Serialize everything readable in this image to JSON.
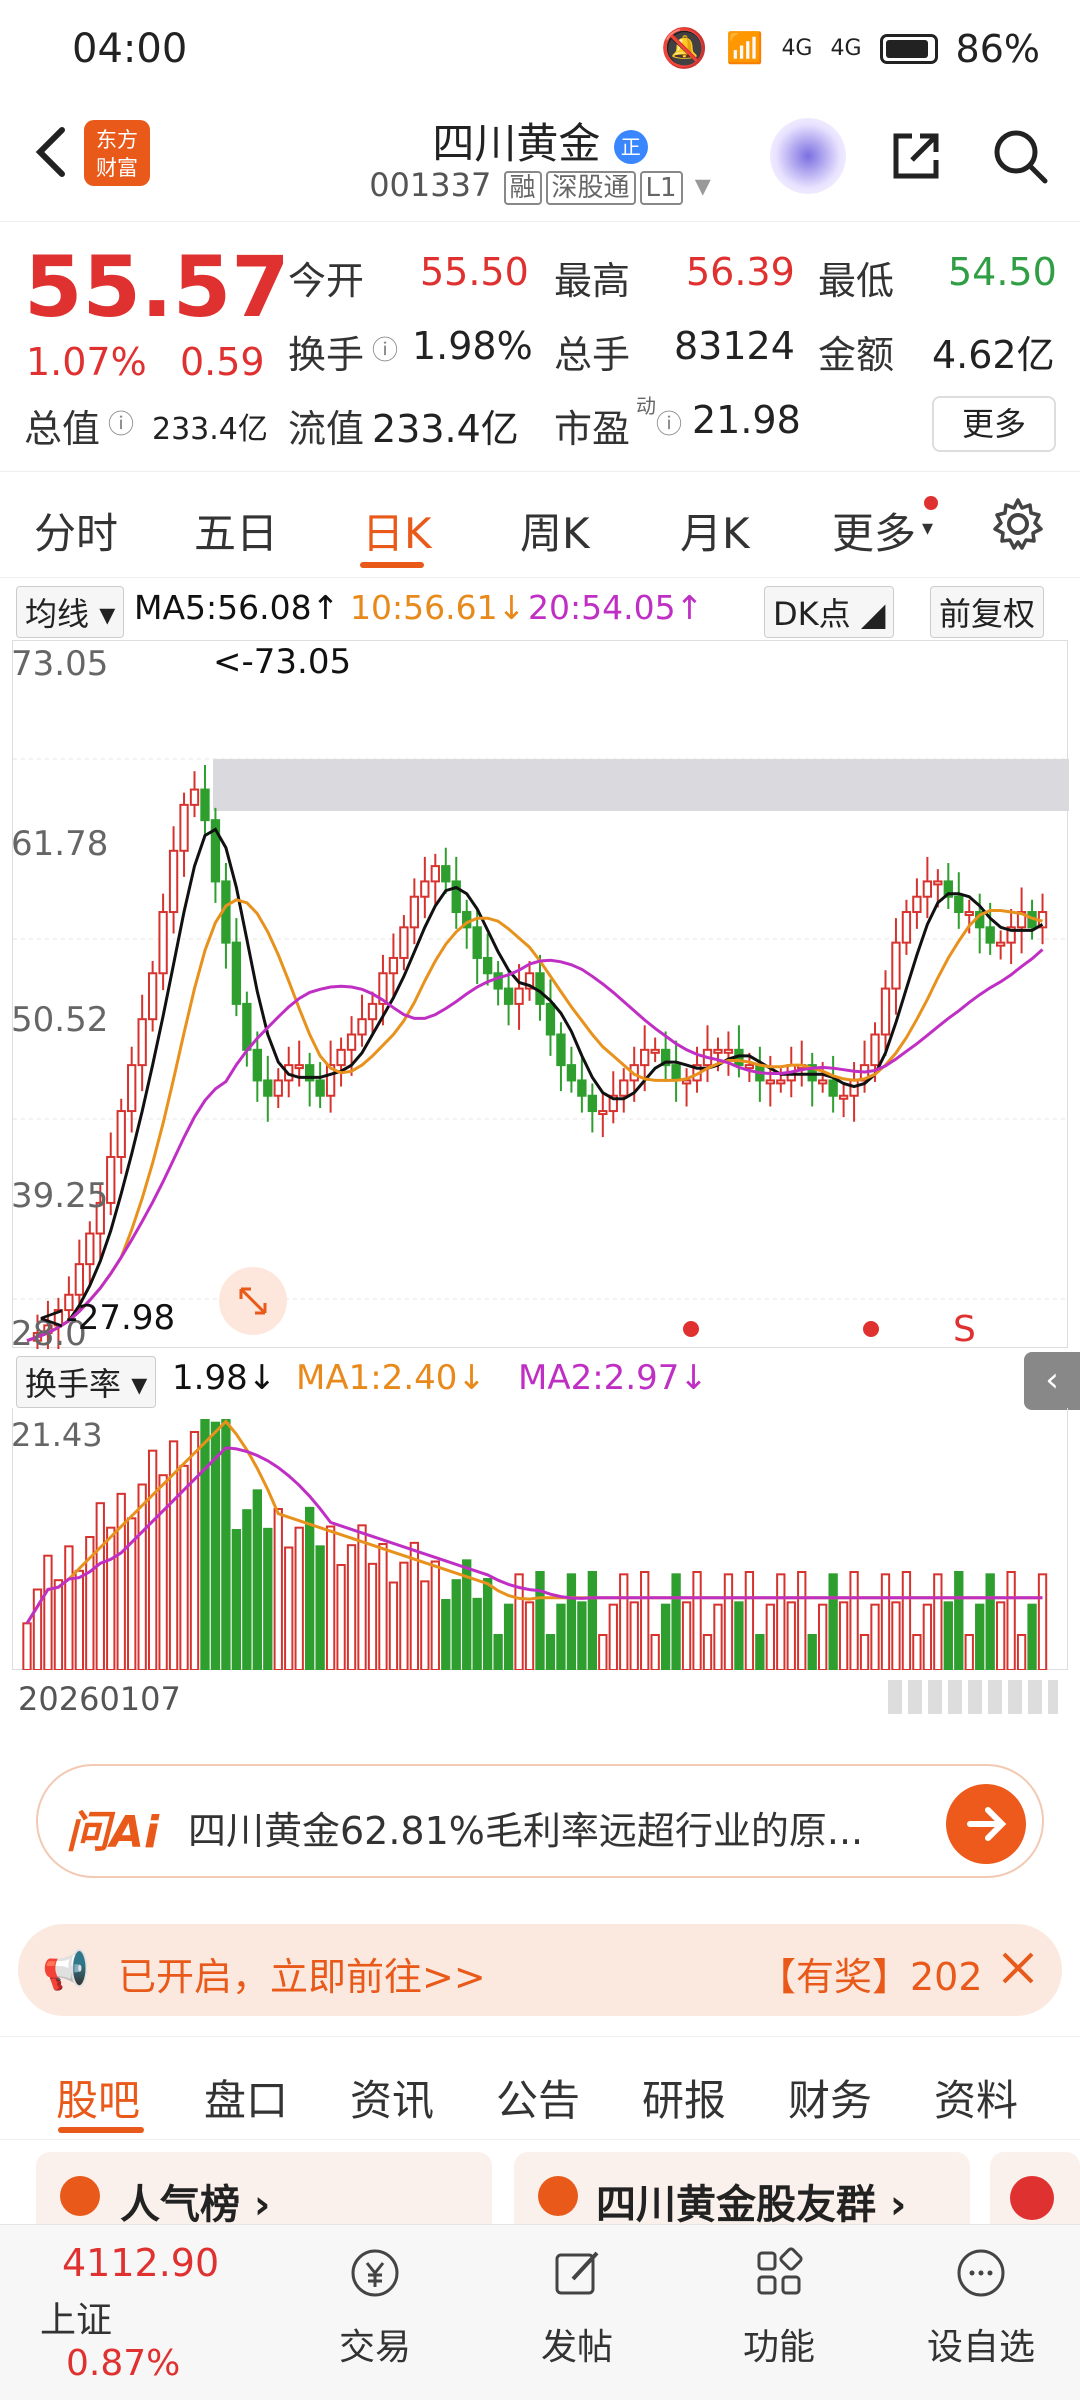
{
  "status_bar": {
    "time": "04:00",
    "battery": "86%",
    "net1": "4G",
    "net2": "4G"
  },
  "header": {
    "title": "四川黄金",
    "title_badge": "正",
    "code": "001337",
    "tags": [
      "融",
      "深股通",
      "L1"
    ],
    "logo_text": "东方\n财富"
  },
  "quote": {
    "price": "55.57",
    "change_pct": "1.07%",
    "change_amt": "0.59",
    "rows": [
      [
        {
          "label": "今开",
          "value": "55.50",
          "color": "red"
        },
        {
          "label": "最高",
          "value": "56.39",
          "color": "red"
        },
        {
          "label": "最低",
          "value": "54.50",
          "color": "green"
        }
      ],
      [
        {
          "label": "换手",
          "value": "1.98%",
          "color": "dark"
        },
        {
          "label": "总手",
          "value": "83124",
          "color": "dark"
        },
        {
          "label": "金额",
          "value": "4.62亿",
          "color": "dark"
        }
      ]
    ],
    "total_value_label": "总值",
    "total_value": "233.4亿",
    "float_value_label": "流值",
    "float_value": "233.4亿",
    "pe_label": "市盈",
    "pe_sup": "动",
    "pe_value": "21.98",
    "more_label": "更多"
  },
  "ktabs": [
    "分时",
    "五日",
    "日K",
    "周K",
    "月K",
    "更多"
  ],
  "ktab_active": "日K",
  "ma_bar": {
    "selector": "均线",
    "ma5": "MA5:56.08",
    "ma10": "10:56.61",
    "ma20": "20:54.05",
    "dk": "DK点",
    "fq": "前复权"
  },
  "kchart": {
    "y_labels": [
      "73.05",
      "61.78",
      "50.52",
      "39.25",
      "28.0"
    ],
    "max_label": "<-73.05",
    "min_label": "<-27.98",
    "sell_marker": "S",
    "colors": {
      "up": "#d6332f",
      "down": "#2e9e2e",
      "ma5": "#111111",
      "ma10": "#e8911c",
      "ma20": "#c02fc4"
    }
  },
  "vol_bar": {
    "selector": "换手率",
    "value": "1.98",
    "ma1": "MA1:2.40",
    "ma2": "MA2:2.97"
  },
  "vol_chart": {
    "y_label": "21.43"
  },
  "date_label": "20260107",
  "ai": {
    "logo": "问Ai",
    "text": "四川黄金62.81%毛利率远超行业的原..."
  },
  "promo": {
    "text": "已开启，立即前往>>",
    "right": "【有奖】202"
  },
  "btabs": [
    "股吧",
    "盘口",
    "资讯",
    "公告",
    "研报",
    "财务",
    "资料"
  ],
  "btab_active": "股吧",
  "cards": [
    {
      "title": "人气榜"
    },
    {
      "title": "四川黄金股友群"
    }
  ],
  "bottom_nav": {
    "index_value": "4112.90",
    "index_name": "上证",
    "index_change": "0.87%",
    "items": [
      {
        "label": "交易",
        "icon": "yen-exchange-icon"
      },
      {
        "label": "发帖",
        "icon": "edit-icon"
      },
      {
        "label": "功能",
        "icon": "grid-icon"
      },
      {
        "label": "设自选",
        "icon": "chat-icon"
      }
    ]
  }
}
